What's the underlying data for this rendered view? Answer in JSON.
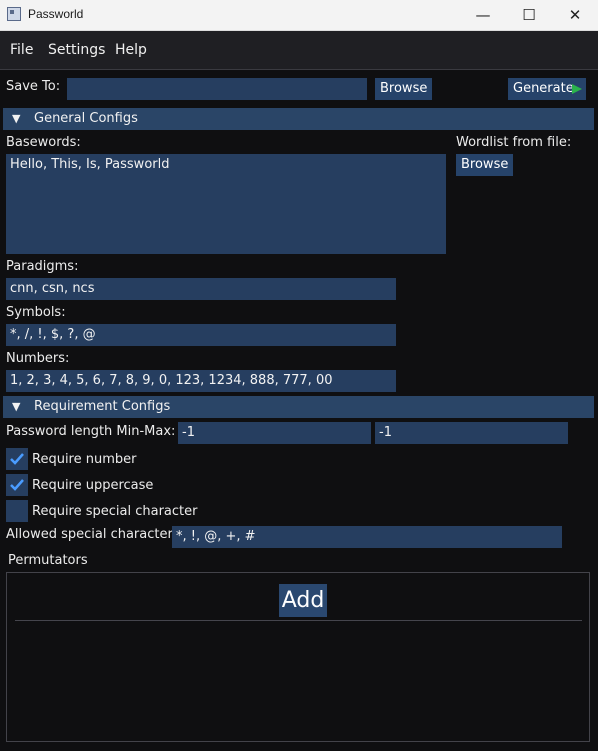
{
  "window": {
    "title": "Passworld",
    "minimize": "—",
    "maximize": "☐",
    "close": "✕"
  },
  "menu": {
    "file": "File",
    "settings": "Settings",
    "help": "Help"
  },
  "toolbar": {
    "save_to_label": "Save To:",
    "save_to_value": "",
    "browse_label": "Browse",
    "generate_label": "Generate",
    "generate_icon": "play-icon",
    "accent_color": "#2bb24c"
  },
  "general": {
    "header": "General Configs",
    "basewords_label": "Basewords:",
    "basewords_value": "Hello, This, Is, Passworld",
    "wordlist_label": "Wordlist from file:",
    "wordlist_browse": "Browse",
    "paradigms_label": "Paradigms:",
    "paradigms_value": "cnn, csn, ncs",
    "symbols_label": "Symbols:",
    "symbols_value": "*, /, !, $, ?, @",
    "numbers_label": "Numbers:",
    "numbers_value": "1, 2, 3, 4, 5, 6, 7, 8, 9, 0, 123, 1234, 888, 777, 00"
  },
  "requirements": {
    "header": "Requirement Configs",
    "length_label": "Password length Min-Max:",
    "min_value": "-1",
    "max_value": "-1",
    "require_number": {
      "label": "Require number",
      "checked": true
    },
    "require_uppercase": {
      "label": "Require uppercase",
      "checked": true
    },
    "require_special": {
      "label": "Require special character",
      "checked": false
    },
    "allowed_special_label": "Allowed special character",
    "allowed_special_value": "*, !, @, +, #"
  },
  "permutators": {
    "label": "Permutators",
    "add_label": "Add"
  },
  "colors": {
    "background": "#0f0f11",
    "field": "#263e60",
    "header": "#2a4567",
    "check": "#4a9cff"
  }
}
